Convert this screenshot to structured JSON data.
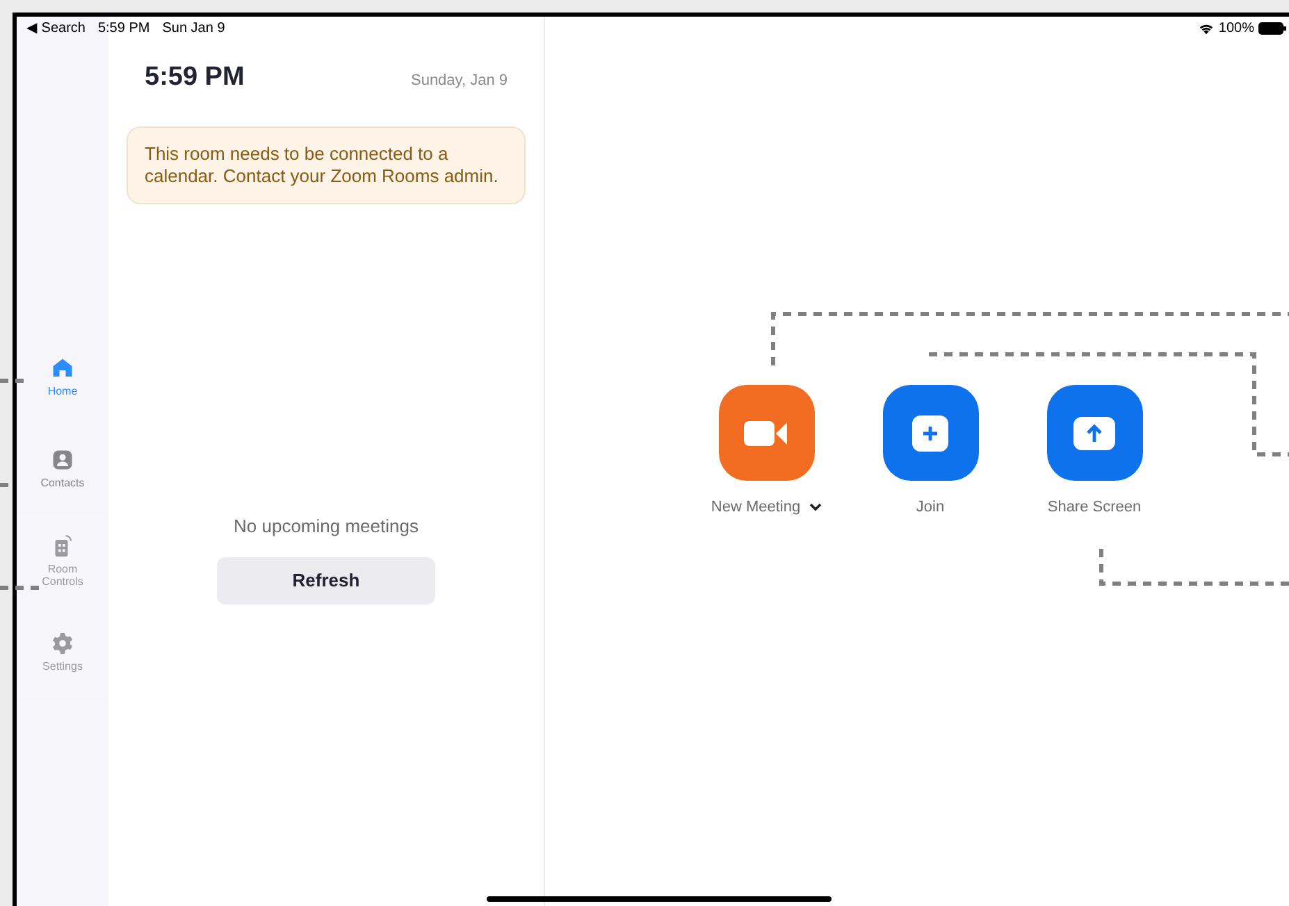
{
  "status_bar": {
    "back": "◀ Search",
    "time": "5:59 PM",
    "date": "Sun Jan 9",
    "battery": "100%"
  },
  "sidebar": {
    "items": [
      {
        "label": "Home",
        "kind": "home",
        "selected": true,
        "disabled": false
      },
      {
        "label": "Contacts",
        "kind": "contacts",
        "selected": false,
        "disabled": false
      },
      {
        "label": "Room\nControls",
        "kind": "controls",
        "selected": false,
        "disabled": true
      },
      {
        "label": "Settings",
        "kind": "settings",
        "selected": false,
        "disabled": true
      }
    ]
  },
  "meetings_panel": {
    "time": "5:59 PM",
    "date": "Sunday, Jan 9",
    "notice": "This room needs to be connected to a calendar. Contact your Zoom Rooms admin.",
    "empty_message": "No upcoming meetings",
    "refresh_button": "Refresh"
  },
  "actions": [
    {
      "label": "New Meeting",
      "kind": "new_meeting",
      "has_menu": true
    },
    {
      "label": "Join",
      "kind": "join",
      "has_menu": false
    },
    {
      "label": "Share Screen",
      "kind": "share",
      "has_menu": false
    }
  ]
}
